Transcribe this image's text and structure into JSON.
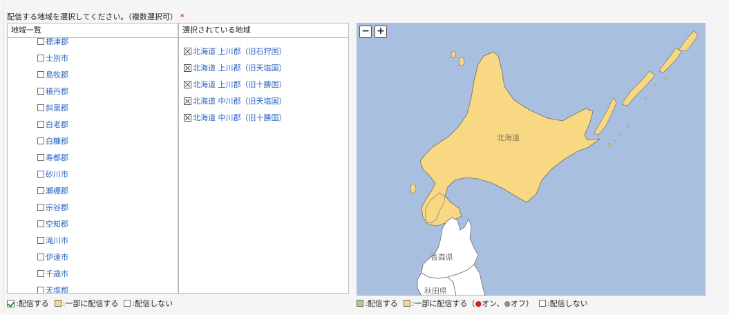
{
  "instruction": "配信する地域を選択してください。（複数選択可）",
  "required_mark": "*",
  "region_list": {
    "header": "地域一覧",
    "items": [
      "標津郡",
      "士別市",
      "島牧郡",
      "積丹郡",
      "斜里郡",
      "白老郡",
      "白糠郡",
      "寿都郡",
      "砂川市",
      "瀬棚郡",
      "宗谷郡",
      "空知郡",
      "滝川市",
      "伊達市",
      "千歳市",
      "天塩郡"
    ]
  },
  "selected_list": {
    "header": "選択されている地域",
    "items": [
      "北海道 上川郡（旧石狩国）",
      "北海道 上川郡（旧天塩国）",
      "北海道 上川郡（旧十勝国）",
      "北海道 中川郡（旧天塩国）",
      "北海道 中川郡（旧十勝国）"
    ]
  },
  "map": {
    "zoom_out_label": "−",
    "zoom_in_label": "+",
    "labels": {
      "hokkaido": "北海道",
      "aomori": "青森県",
      "akita": "秋田県"
    },
    "colors": {
      "sea": "#a9bfdf",
      "partial": "#f8d882",
      "none": "#ffffff",
      "border": "#6c6c6c"
    }
  },
  "legend_left": {
    "full": ":配信する",
    "partial": ":一部に配信する",
    "none": ":配信しない"
  },
  "legend_right": {
    "full": ":配信する",
    "partial": ":一部に配信する（",
    "pin_on": "オン、",
    "pin_off": "オフ）",
    "none": ":配信しない",
    "full_color": "#a7cf8a",
    "partial_color": "#f8d882"
  }
}
